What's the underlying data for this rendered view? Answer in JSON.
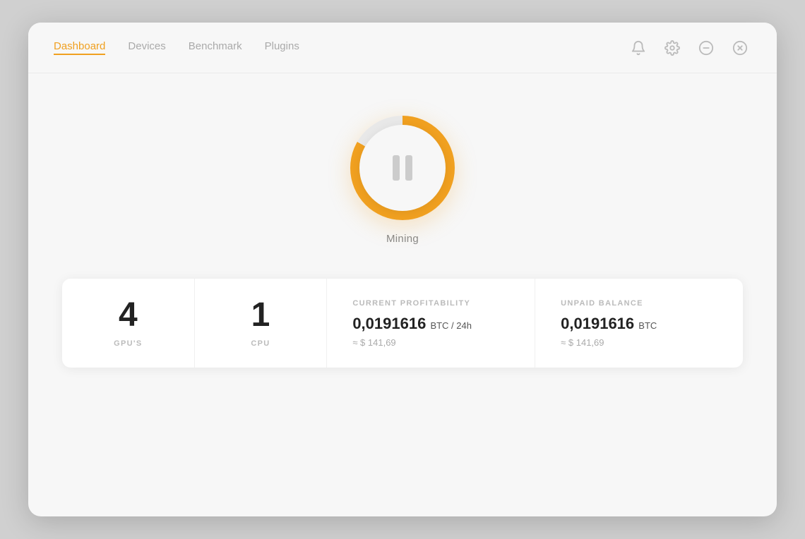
{
  "nav": {
    "items": [
      {
        "id": "dashboard",
        "label": "Dashboard",
        "active": true
      },
      {
        "id": "devices",
        "label": "Devices",
        "active": false
      },
      {
        "id": "benchmark",
        "label": "Benchmark",
        "active": false
      },
      {
        "id": "plugins",
        "label": "Plugins",
        "active": false
      }
    ]
  },
  "header_icons": {
    "bell": "🔔",
    "gear": "⚙",
    "minimize": "−",
    "close": "⊗"
  },
  "mining": {
    "status_label": "Mining"
  },
  "stats": {
    "gpu_count": "4",
    "gpu_label": "GPU'S",
    "cpu_count": "1",
    "cpu_label": "CPU",
    "profitability": {
      "header": "CURRENT PROFITABILITY",
      "value": "0,0191616",
      "unit": "BTC / 24h",
      "usd": "≈ $ 141,69"
    },
    "balance": {
      "header": "UNPAID BALANCE",
      "value": "0,0191616",
      "unit": "BTC",
      "usd": "≈ $ 141,69"
    }
  }
}
